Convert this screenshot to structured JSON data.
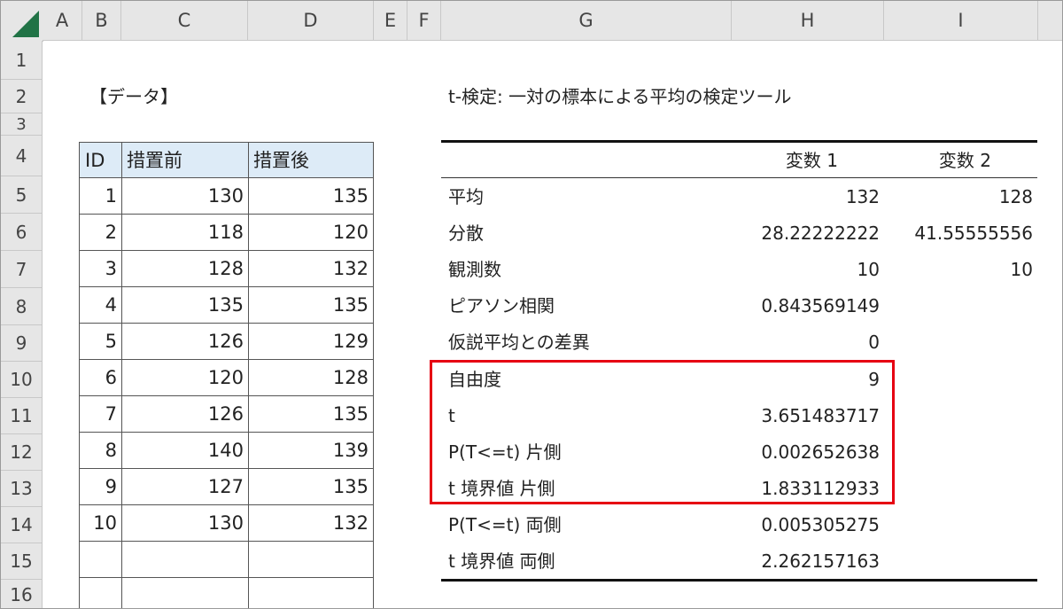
{
  "columns": [
    "A",
    "B",
    "C",
    "D",
    "E",
    "F",
    "G",
    "H",
    "I"
  ],
  "rows": [
    "1",
    "2",
    "3",
    "4",
    "5",
    "6",
    "7",
    "8",
    "9",
    "10",
    "11",
    "12",
    "13",
    "14",
    "15",
    "16"
  ],
  "data_title": "【データ】",
  "data_table": {
    "headers": [
      "ID",
      "措置前",
      "措置後"
    ],
    "rows": [
      [
        "1",
        "130",
        "135"
      ],
      [
        "2",
        "118",
        "120"
      ],
      [
        "3",
        "128",
        "132"
      ],
      [
        "4",
        "135",
        "135"
      ],
      [
        "5",
        "126",
        "129"
      ],
      [
        "6",
        "120",
        "128"
      ],
      [
        "7",
        "126",
        "135"
      ],
      [
        "8",
        "140",
        "139"
      ],
      [
        "9",
        "127",
        "135"
      ],
      [
        "10",
        "130",
        "132"
      ],
      [
        "",
        "",
        ""
      ],
      [
        "",
        "",
        ""
      ]
    ]
  },
  "test": {
    "title": "t-検定: 一対の標本による平均の検定ツール",
    "headers": [
      "",
      "変数 1",
      "変数 2"
    ],
    "rows": [
      [
        "平均",
        "132",
        "128"
      ],
      [
        "分散",
        "28.22222222",
        "41.55555556"
      ],
      [
        "観測数",
        "10",
        "10"
      ],
      [
        "ピアソン相関",
        "0.843569149",
        ""
      ],
      [
        "仮説平均との差異",
        "0",
        ""
      ],
      [
        "自由度",
        "9",
        ""
      ],
      [
        "t",
        "3.651483717",
        ""
      ],
      [
        "P(T<=t) 片側",
        "0.002652638",
        ""
      ],
      [
        "t 境界値 片側",
        "1.833112933",
        ""
      ],
      [
        "P(T<=t) 両側",
        "0.005305275",
        ""
      ],
      [
        "t 境界値 両側",
        "2.262157163",
        ""
      ]
    ]
  },
  "colors": {
    "excel_green": "#217346",
    "highlight_red": "#e60012",
    "header_blue": "#ddebf7"
  }
}
